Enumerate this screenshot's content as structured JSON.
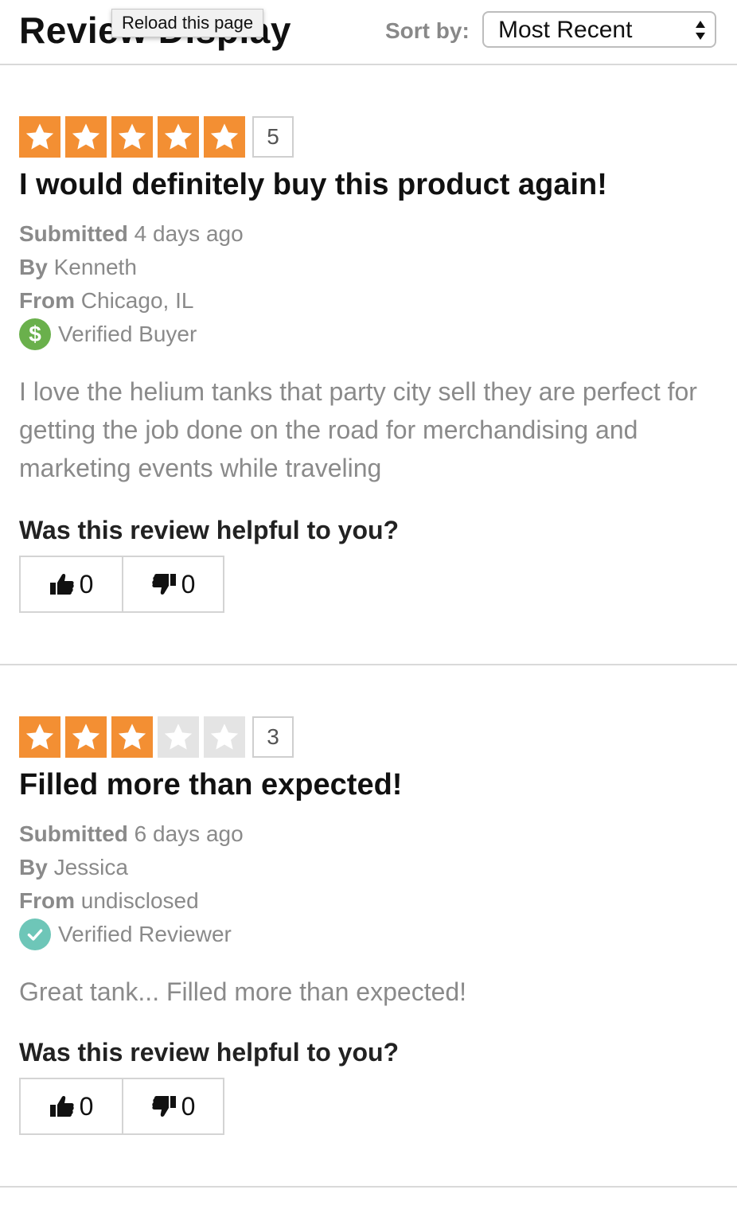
{
  "header": {
    "title": "Review Display",
    "tooltip": "Reload this page",
    "sort_label": "Sort by:",
    "sort_value": "Most Recent"
  },
  "reviews": [
    {
      "rating": 5,
      "rating_label": "5",
      "title": "I would definitely buy this product again!",
      "submitted_label": "Submitted",
      "submitted_value": "4 days ago",
      "by_label": "By",
      "by_value": "Kenneth",
      "from_label": "From",
      "from_value": "Chicago, IL",
      "badge_icon": "dollar-icon",
      "badge": "Verified Buyer",
      "body": "I love the helium tanks that party city sell they are perfect for getting the job done on the road for merchandising and marketing events while traveling",
      "helpful_question": "Was this review helpful to you?",
      "upvotes": "0",
      "downvotes": "0"
    },
    {
      "rating": 3,
      "rating_label": "3",
      "title": "Filled more than expected!",
      "submitted_label": "Submitted",
      "submitted_value": "6 days ago",
      "by_label": "By",
      "by_value": "Jessica",
      "from_label": "From",
      "from_value": "undisclosed",
      "badge_icon": "checkmark-icon",
      "badge": "Verified Reviewer",
      "body": "Great tank... Filled more than expected!",
      "helpful_question": "Was this review helpful to you?",
      "upvotes": "0",
      "downvotes": "0"
    }
  ],
  "colors": {
    "star_filled": "#f38f33",
    "star_empty": "#e4e4e4",
    "verified_buyer": "#6ab04c",
    "verified_reviewer": "#6ec6b8"
  }
}
